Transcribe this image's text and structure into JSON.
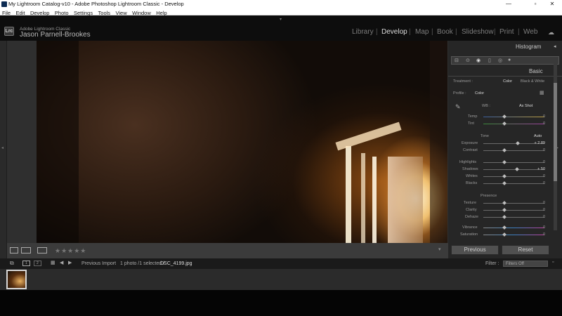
{
  "window": {
    "title": "My Lightroom Catalog-v10 - Adobe Photoshop Lightroom Classic - Develop",
    "min": "—",
    "max": "▫",
    "close": "✕"
  },
  "menu": [
    "File",
    "Edit",
    "Develop",
    "Photo",
    "Settings",
    "Tools",
    "View",
    "Window",
    "Help"
  ],
  "identity": {
    "logo": "Lrc",
    "product": "Adobe Lightroom Classic",
    "user": "Jason Parnell-Brookes"
  },
  "modules": [
    "Library",
    "Develop",
    "Map",
    "Book",
    "Slideshow",
    "Print",
    "Web"
  ],
  "active_module": "Develop",
  "panel": {
    "histogram": "Histogram",
    "basic": "Basic",
    "treatment_label": "Treatment :",
    "treatment_color": "Color",
    "treatment_bw": "Black & White",
    "profile_label": "Profile :",
    "profile_value": "Color",
    "wb_label": "WB :",
    "wb_value": "As Shot",
    "temp": {
      "label": "Temp",
      "value": "0"
    },
    "tint": {
      "label": "Tint",
      "value": "0"
    },
    "tone": "Tone",
    "auto": "Auto",
    "exposure": {
      "label": "Exposure",
      "value": "+ 2.89"
    },
    "contrast": {
      "label": "Contrast",
      "value": "0"
    },
    "highlights": {
      "label": "Highlights",
      "value": "0"
    },
    "shadows": {
      "label": "Shadows",
      "value": "+ 50"
    },
    "whites": {
      "label": "Whites",
      "value": "0"
    },
    "blacks": {
      "label": "Blacks",
      "value": "0"
    },
    "presence": "Presence",
    "texture": {
      "label": "Texture",
      "value": "0"
    },
    "clarity": {
      "label": "Clarity",
      "value": "0"
    },
    "dehaze": {
      "label": "Dehaze",
      "value": "0"
    },
    "vibrance": {
      "label": "Vibrance",
      "value": "0"
    },
    "saturation": {
      "label": "Saturation",
      "value": "0"
    },
    "previous": "Previous",
    "reset": "Reset"
  },
  "toolbar": {
    "stars": "★★★★★"
  },
  "filmstrip": {
    "page1": "1",
    "page2": "2",
    "source": "Previous Import",
    "count": "1 photo /1 selected /",
    "filename": "DSC_4199.jpg",
    "filter_label": "Filter :",
    "filter_value": "Filters Off"
  }
}
